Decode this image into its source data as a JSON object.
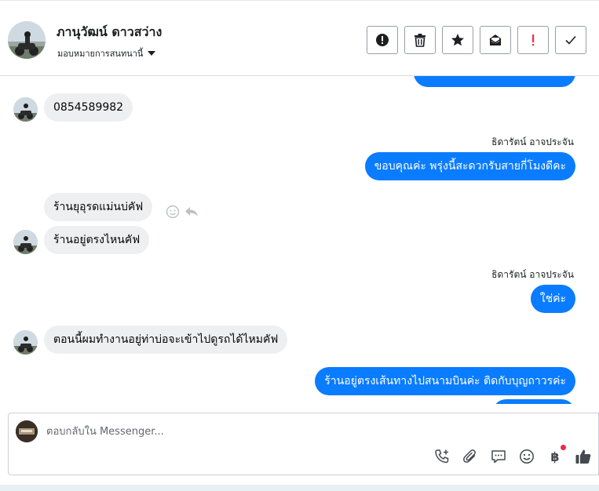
{
  "header": {
    "contact_name": "ภานุวัฒน์ ดาวสว่าง",
    "assign_label": "มอบหมายการสนทนานี้",
    "actions": [
      {
        "icon": "info-icon",
        "name": "spam-button"
      },
      {
        "icon": "trash-icon",
        "name": "delete-button"
      },
      {
        "icon": "star-icon",
        "name": "star-button"
      },
      {
        "icon": "mail-icon",
        "name": "mark-unread-button"
      },
      {
        "icon": "exclamation-icon",
        "name": "follow-up-button"
      },
      {
        "icon": "checkmark-icon",
        "name": "done-button"
      }
    ]
  },
  "thread": {
    "messages": [
      {
        "direction": "in",
        "text": "0854589982"
      },
      {
        "direction": "out",
        "sender": "ธิดารัตน์ อาจประจัน",
        "text": "ขอบคุณค่ะ พรุ่งนี้สะดวกรับสายกี่โมงดีคะ"
      },
      {
        "direction": "in",
        "text": "ร้านยุอุรดแม่นบ่คัฟ"
      },
      {
        "direction": "in",
        "text": "ร้านอยู่ตรงไหนคัฟ"
      },
      {
        "direction": "out",
        "sender": "ธิดารัตน์ อาจประจัน",
        "text": "ใช่ค่ะ"
      },
      {
        "direction": "in",
        "text": "ตอนนี้ผมทำงานอยู่ท่าบ่อจะเข้าไปดูรถได้ไหมคัฟ"
      },
      {
        "direction": "out",
        "text": "ร้านอยู่ตรงเส้นทางไปสนามบินค่ะ ติดกับบุญถาวรค่ะ"
      }
    ]
  },
  "composer": {
    "placeholder": "ตอบกลับใน Messenger...",
    "tools": [
      "add-call-icon",
      "paperclip-icon",
      "saved-reply-icon",
      "emoji-icon",
      "baht-payment-icon",
      "thumbs-up-icon"
    ],
    "baht_symbol": "฿"
  },
  "colors": {
    "accent": "#0a7cff",
    "incoming_bubble": "#eeeff1",
    "notification_dot": "#f02849"
  }
}
